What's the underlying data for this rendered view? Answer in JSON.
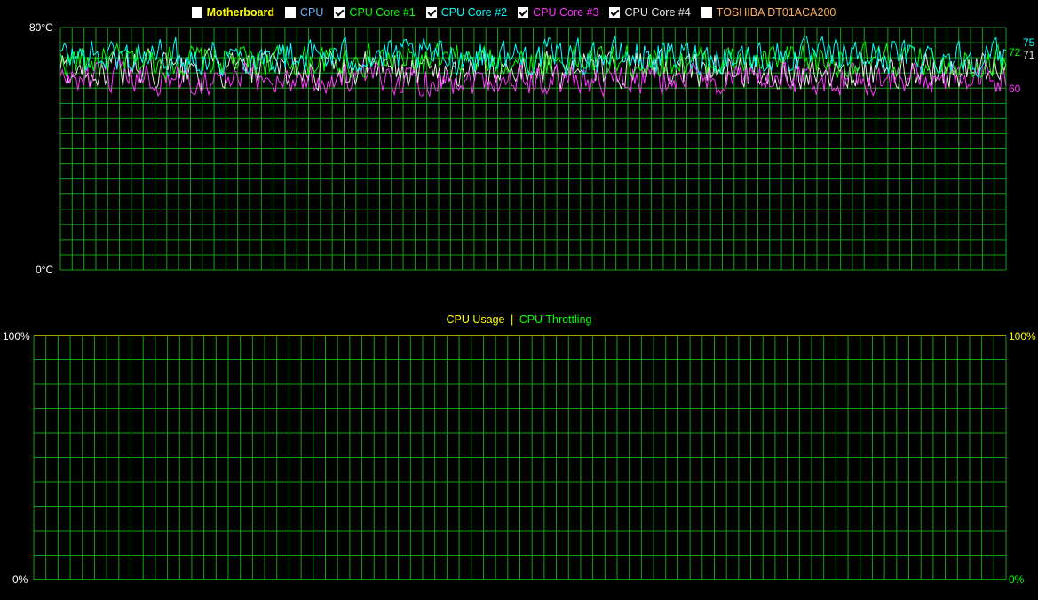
{
  "legend": {
    "items": [
      {
        "label": "Motherboard",
        "checked": false,
        "color": "#FFFF00",
        "bold": true
      },
      {
        "label": "CPU",
        "checked": false,
        "color": "#6FB3FF",
        "bold": false
      },
      {
        "label": "CPU Core #1",
        "checked": true,
        "color": "#00FF00",
        "bold": false
      },
      {
        "label": "CPU Core #2",
        "checked": true,
        "color": "#00FFFF",
        "bold": false
      },
      {
        "label": "CPU Core #3",
        "checked": true,
        "color": "#FF33FF",
        "bold": false
      },
      {
        "label": "CPU Core #4",
        "checked": true,
        "color": "#E8E8E8",
        "bold": false
      },
      {
        "label": "TOSHIBA DT01ACA200",
        "checked": false,
        "color": "#FFB060",
        "bold": false
      }
    ]
  },
  "temp_chart": {
    "y_top_label": "80°C",
    "y_bottom_label": "0°C",
    "current_values": [
      {
        "value": "75",
        "color": "#00FFFF"
      },
      {
        "value": "72",
        "color": "#00FF00"
      },
      {
        "value": "71",
        "color": "#E8E8E8"
      },
      {
        "value": "60",
        "color": "#FF33FF"
      }
    ]
  },
  "usage_chart": {
    "title_usage": "CPU Usage",
    "separator": "|",
    "title_throttling": "CPU Throttling",
    "usage_color": "#FFFF00",
    "throttling_color": "#00FF00",
    "y_top_left": "100%",
    "y_bottom_left": "0%",
    "y_top_right": "100%",
    "y_bottom_right": "0%"
  },
  "chart_data": [
    {
      "type": "line",
      "title": "",
      "ylabel": "",
      "ylim": [
        0,
        80
      ],
      "grid": true,
      "series": [
        {
          "name": "CPU Core #1",
          "color": "#00FF00",
          "approx_range": [
            62,
            76
          ],
          "current": 72
        },
        {
          "name": "CPU Core #2",
          "color": "#00FFFF",
          "approx_range": [
            63,
            78
          ],
          "current": 75
        },
        {
          "name": "CPU Core #3",
          "color": "#FF33FF",
          "approx_range": [
            56,
            70
          ],
          "current": 60
        },
        {
          "name": "CPU Core #4",
          "color": "#E8E8E8",
          "approx_range": [
            58,
            74
          ],
          "current": 71
        }
      ]
    },
    {
      "type": "line",
      "title": "CPU Usage | CPU Throttling",
      "ylim": [
        0,
        100
      ],
      "grid": true,
      "series": [
        {
          "name": "CPU Usage",
          "color": "#FFFF00",
          "value": 100
        },
        {
          "name": "CPU Throttling",
          "color": "#00FF00",
          "value": 0
        }
      ]
    }
  ]
}
